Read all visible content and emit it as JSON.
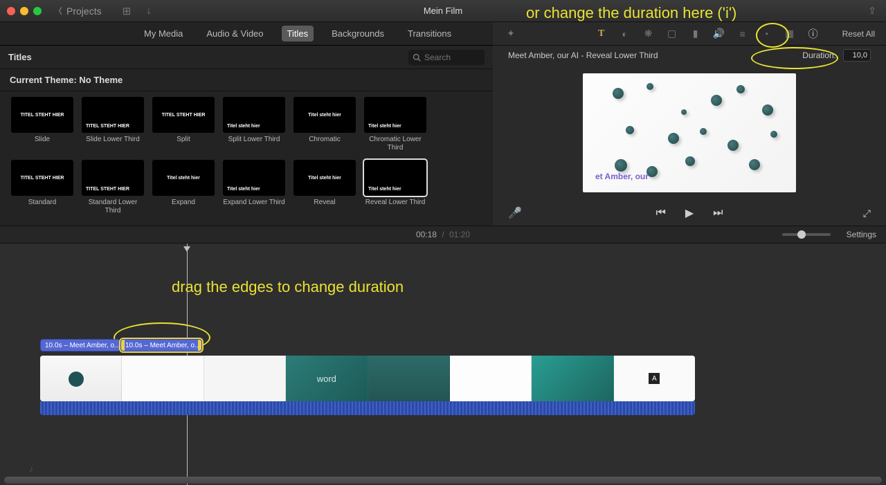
{
  "titlebar": {
    "back_label": "Projects",
    "film_title": "Mein Film"
  },
  "tabs": {
    "my_media": "My Media",
    "audio_video": "Audio & Video",
    "titles": "Titles",
    "backgrounds": "Backgrounds",
    "transitions": "Transitions"
  },
  "browser": {
    "header": "Titles",
    "search_placeholder": "Search",
    "theme_label": "Current Theme: No Theme"
  },
  "titles_list": [
    {
      "name": "Slide",
      "text": "TITEL STEHT HIER",
      "style": "center"
    },
    {
      "name": "Slide Lower Third",
      "text": "TITEL STEHT HIER",
      "style": "left"
    },
    {
      "name": "Split",
      "text": "TITEL STEHT HIER",
      "style": "center"
    },
    {
      "name": "Split Lower Third",
      "text": "Titel steht hier",
      "style": "left"
    },
    {
      "name": "Chromatic",
      "text": "Titel steht hier",
      "style": "center"
    },
    {
      "name": "Chromatic Lower Third",
      "text": "Titel steht hier",
      "style": "left"
    },
    {
      "name": "Standard",
      "text": "TITEL STEHT HIER",
      "style": "center"
    },
    {
      "name": "Standard Lower Third",
      "text": "TITEL STEHT HIER",
      "style": "left"
    },
    {
      "name": "Expand",
      "text": "Titel steht hier",
      "style": "center"
    },
    {
      "name": "Expand Lower Third",
      "text": "Titel steht hier",
      "style": "left"
    },
    {
      "name": "Reveal",
      "text": "Titel steht hier",
      "style": "center"
    },
    {
      "name": "Reveal Lower Third",
      "text": "Titel steht hier",
      "style": "left",
      "selected": true
    }
  ],
  "inspector": {
    "clip_name": "Meet Amber, our AI - Reveal Lower Third",
    "duration_label": "Duration:",
    "duration_value": "10,0",
    "reset": "Reset All",
    "overlay_text": "et Amber, our"
  },
  "time": {
    "current": "00:18",
    "total": "01:20"
  },
  "settings_label": "Settings",
  "timeline": {
    "title_clip_1": "10.0s – Meet Amber, o...",
    "title_clip_2": "10.0s – Meet Amber, o...",
    "word": "word"
  },
  "annotations": {
    "top": "or change the duration here ('i')",
    "drag": "drag the edges to change duration"
  }
}
